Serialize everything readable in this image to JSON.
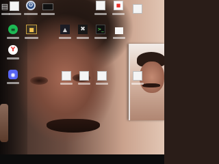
{
  "desktop": {
    "icons": [
      {
        "name": "shortcut-icon"
      },
      {
        "name": "document-icon"
      },
      {
        "name": "settings-icon"
      },
      {
        "name": "monitor-icon"
      },
      {
        "name": "document-icon-2"
      },
      {
        "name": "pdf-icon"
      },
      {
        "name": "spotify-icon"
      },
      {
        "name": "folder-icon"
      },
      {
        "name": "game-icon"
      },
      {
        "name": "game-icon-2"
      },
      {
        "name": "terminal-icon"
      },
      {
        "name": "blank-file-icon"
      },
      {
        "name": "yandex-icon"
      },
      {
        "name": "discord-icon"
      },
      {
        "name": "file-icon-1"
      },
      {
        "name": "file-icon-2"
      },
      {
        "name": "file-icon-3"
      },
      {
        "name": "file-icon-4"
      },
      {
        "name": "file-icon-5"
      }
    ]
  },
  "colors": {
    "accent": "#e8302a",
    "spotify": "#1db954",
    "discord": "#5865f2",
    "taskbar": "#0c0c0c"
  }
}
